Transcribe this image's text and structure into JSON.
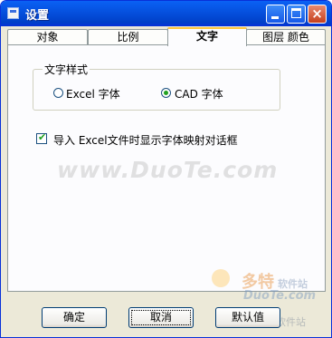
{
  "window": {
    "title": "设置",
    "controls": {
      "minimize": "minimize",
      "maximize": "maximize",
      "close": "×"
    }
  },
  "tabs": [
    {
      "label": "对象",
      "active": false
    },
    {
      "label": "比例",
      "active": false
    },
    {
      "label": "文字",
      "active": true
    },
    {
      "label": "图层 颜色",
      "active": false
    }
  ],
  "text_style": {
    "group_label": "文字样式",
    "options": [
      {
        "label": "Excel 字体",
        "selected": false
      },
      {
        "label": "CAD 字体",
        "selected": true
      }
    ]
  },
  "font_mapping": {
    "label": "导入 Excel文件时显示字体映射对话框",
    "checked": true
  },
  "buttons": {
    "ok": "确定",
    "cancel": "取消",
    "defaults": "默认值"
  },
  "watermark": {
    "main": "www.DuoTe.com",
    "logo_cn": "多特",
    "logo_suffix": "软件站",
    "logo_en": "DuoTe.com",
    "logo_bottom": "国内最安全的软件站"
  },
  "colors": {
    "titlebar": "#0652e0",
    "active_tab_accent": "#ffc83c",
    "dialog_bg": "#ece9d8",
    "radio_dot": "#21a121"
  }
}
